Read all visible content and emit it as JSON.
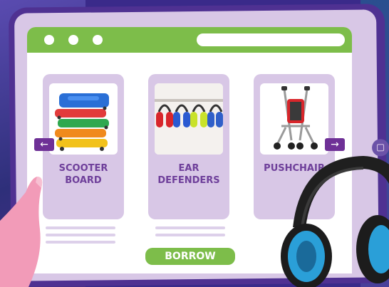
{
  "carousel": {
    "items": [
      {
        "label": "SCOOTER\nBOARD",
        "image": "scooter-board"
      },
      {
        "label": "EAR\nDEFENDERS",
        "image": "ear-defenders"
      },
      {
        "label": "PUSHCHAIR",
        "image": "pushchair"
      }
    ],
    "prev_icon": "←",
    "next_icon": "→"
  },
  "borrow_button": {
    "label": "BORROW"
  },
  "colors": {
    "accent_green": "#7dbd4a",
    "accent_purple": "#6e3096",
    "card_lilac": "#d8c7e6",
    "tablet_frame": "#4f3192"
  }
}
